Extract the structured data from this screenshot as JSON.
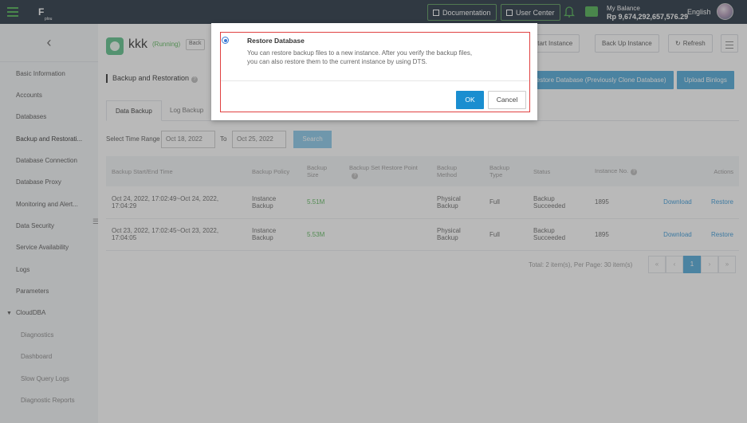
{
  "topbar": {
    "logo_text": "F",
    "logo_sub": "plou",
    "documentation": "Documentation",
    "user_center": "User Center",
    "balance_label": "My Balance",
    "balance_amount": "Rp 9,674,292,657,576.29",
    "language": "English",
    "accent_color": "#4caf50"
  },
  "sidebar": {
    "back_glyph": "‹",
    "items": [
      "Basic Information",
      "Accounts",
      "Databases",
      "Backup and Restorati...",
      "Database Connection",
      "Database Proxy",
      "Monitoring and Alert...",
      "Data Security",
      "Service Availability",
      "Logs",
      "Parameters",
      "CloudDBA"
    ],
    "sub_items": [
      "Diagnostics",
      "Dashboard",
      "Slow Query Logs",
      "Diagnostic Reports"
    ],
    "collapse_glyph": "☰"
  },
  "instance": {
    "name": "kkk",
    "status": "(Running)",
    "back_label": "Back"
  },
  "header_buttons": {
    "restart": "Restart Instance",
    "backup": "Back Up Instance",
    "refresh": "Refresh"
  },
  "section": {
    "title": "Backup and Restoration",
    "restore_clone": "Restore Database (Previously Clone Database)",
    "upload_binlogs": "Upload Binlogs"
  },
  "tabs": [
    "Data Backup",
    "Log Backup"
  ],
  "filter": {
    "label": "Select Time Range",
    "from": "Oct 18, 2022",
    "to_label": "To",
    "to": "Oct 25, 2022",
    "search": "Search"
  },
  "table": {
    "headers": {
      "time": "Backup Start/End Time",
      "policy": "Backup Policy",
      "size": "Backup Size",
      "restore_point": "Backup Set Restore Point",
      "method": "Backup Method",
      "type": "Backup Type",
      "status": "Status",
      "instance_no": "Instance No.",
      "actions": "Actions"
    },
    "rows": [
      {
        "time": "Oct 24, 2022, 17:02:49~Oct 24, 2022, 17:04:29",
        "policy": "Instance Backup",
        "size": "5.51M",
        "restore_point": "",
        "method": "Physical Backup",
        "type": "Full",
        "status": "Backup Succeeded",
        "instance_no": "1895",
        "download": "Download",
        "restore": "Restore"
      },
      {
        "time": "Oct 23, 2022, 17:02:45~Oct 23, 2022, 17:04:05",
        "policy": "Instance Backup",
        "size": "5.53M",
        "restore_point": "",
        "method": "Physical Backup",
        "type": "Full",
        "status": "Backup Succeeded",
        "instance_no": "1895",
        "download": "Download",
        "restore": "Restore"
      }
    ]
  },
  "pager": {
    "total": "Total: 2 item(s),  Per Page: 30 item(s)",
    "first": "«",
    "prev": "‹",
    "current": "1",
    "next": "›",
    "last": "»"
  },
  "modal": {
    "title": "Restore Database",
    "description": "You can restore backup files to a new instance. After you verify the backup files, you can also restore them to the current instance by using DTS.",
    "ok": "OK",
    "cancel": "Cancel",
    "highlight_color": "#e04040"
  }
}
